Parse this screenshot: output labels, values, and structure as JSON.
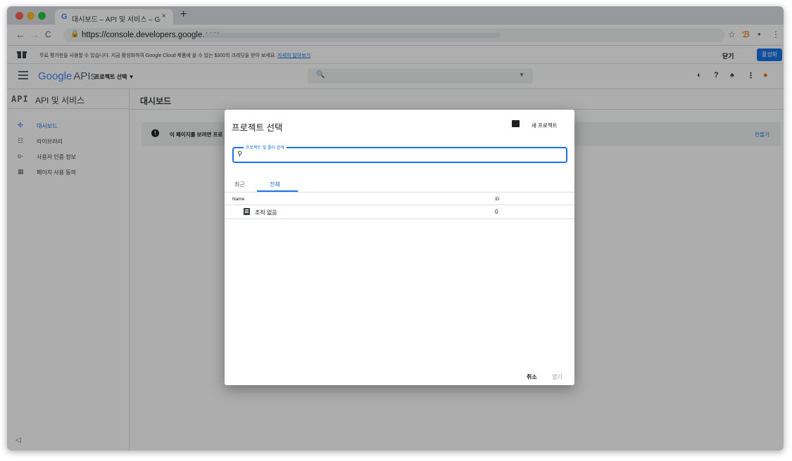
{
  "browser": {
    "tab_title": "대시보드 – API 및 서비스 – Google",
    "tab_close": "×",
    "new_tab": "+",
    "url": "https://console.developers.google.com",
    "back": "←",
    "forward": "→",
    "reload": "C",
    "star": "☆",
    "menu": "⋮"
  },
  "banner": {
    "message": "무료 평가판을 사용할 수 있습니다. 지금 활성화하여 Google Cloud 제품에 쓸 수 있는 $300의 크레딧을 받아 보세요.",
    "link": "자세히 알아보기",
    "close": "닫기",
    "activate": "활성화"
  },
  "header": {
    "logo_google": "Google",
    "logo_apis": "APIs",
    "project_select": "프로젝트 선택",
    "search_icon": "search-icon"
  },
  "sidebar": {
    "api_badge": "API",
    "title": "API 및 서비스",
    "items": [
      {
        "label": "대시보드",
        "icon": "dashboard-icon",
        "active": true
      },
      {
        "label": "라이브러리",
        "icon": "library-icon",
        "active": false
      },
      {
        "label": "사용자 인증 정보",
        "icon": "key-icon",
        "active": false
      },
      {
        "label": "페이지 사용 동의",
        "icon": "consent-icon",
        "active": false
      }
    ]
  },
  "main": {
    "title": "대시보드",
    "notice": "이 페이지를 보려면 프로",
    "create": "만들기"
  },
  "dialog": {
    "title": "프로젝트 선택",
    "new_project": "새 프로젝트",
    "search_label": "프로젝트 및 폴더 검색",
    "search_value": "",
    "tabs": [
      "최근",
      "전체"
    ],
    "selected_tab": "전체",
    "columns": {
      "name": "Name",
      "id": "ID"
    },
    "rows": [
      {
        "name": "조직 없음",
        "id": "0",
        "icon": "building-icon"
      }
    ],
    "cancel": "취소",
    "open": "열기"
  },
  "colors": {
    "accent": "#1a73e8",
    "overlay": "rgba(0,0,0,0.32)"
  }
}
